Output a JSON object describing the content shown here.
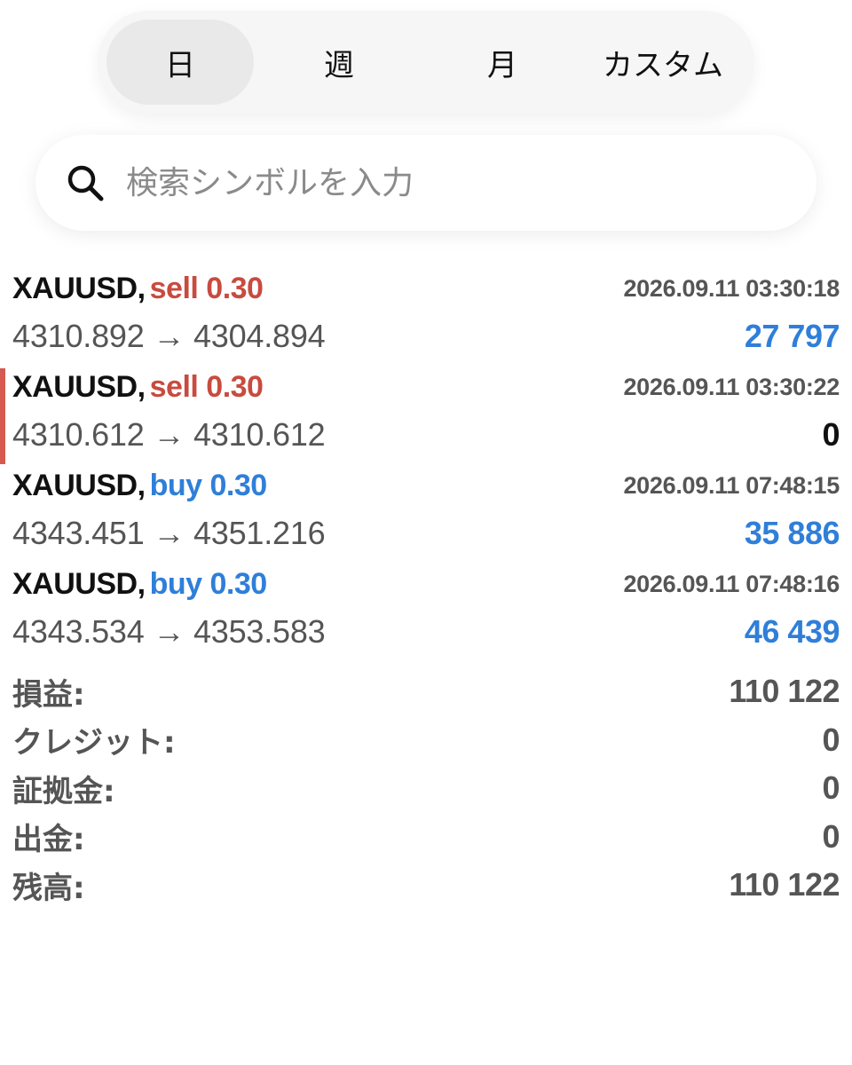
{
  "period_tabs": [
    {
      "label": "日",
      "active": true
    },
    {
      "label": "週",
      "active": false
    },
    {
      "label": "月",
      "active": false
    },
    {
      "label": "カスタム",
      "active": false
    }
  ],
  "search": {
    "placeholder": "検索シンボルを入力",
    "icon": "search-icon"
  },
  "trades": [
    {
      "symbol": "XAUUSD,",
      "side": "sell 0.30",
      "direction": "sell",
      "time": "2026.09.11 03:30:18",
      "prices": "4310.892 → 4304.894",
      "profit": "27 797",
      "profit_color": "#2f7fd9"
    },
    {
      "symbol": "XAUUSD,",
      "side": "sell 0.30",
      "direction": "sell",
      "time": "2026.09.11 03:30:22",
      "prices": "4310.612 → 4310.612",
      "profit": "0",
      "profit_color": "#111111"
    },
    {
      "symbol": "XAUUSD,",
      "side": "buy 0.30",
      "direction": "buy",
      "time": "2026.09.11 07:48:15",
      "prices": "4343.451 → 4351.216",
      "profit": "35 886",
      "profit_color": "#2f7fd9"
    },
    {
      "symbol": "XAUUSD,",
      "side": "buy 0.30",
      "direction": "buy",
      "time": "2026.09.11 07:48:16",
      "prices": "4343.534 → 4353.583",
      "profit": "46 439",
      "profit_color": "#2f7fd9"
    }
  ],
  "summary": [
    {
      "label": "損益:",
      "value": "110 122"
    },
    {
      "label": "クレジット:",
      "value": "0"
    },
    {
      "label": "証拠金:",
      "value": "0"
    },
    {
      "label": "出金:",
      "value": "0"
    },
    {
      "label": "残高:",
      "value": "110 122"
    }
  ],
  "colors": {
    "sell": "#c84b3f",
    "buy": "#2f7fd9",
    "marker": "#d65a4f"
  }
}
